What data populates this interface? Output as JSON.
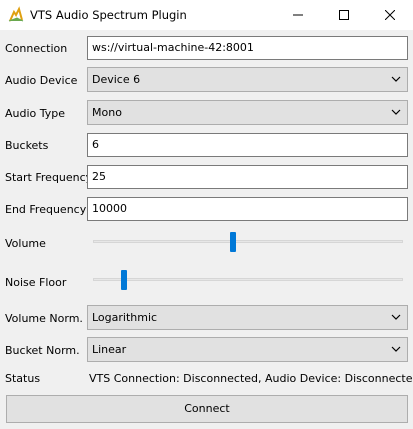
{
  "window": {
    "title": "VTS Audio Spectrum Plugin",
    "icon": "vts-plugin-icon",
    "controls": [
      "minimize-icon",
      "maximize-icon",
      "close-icon"
    ]
  },
  "form": {
    "connection": {
      "label": "Connection",
      "value": "ws://virtual-machine-42:8001"
    },
    "audio_device": {
      "label": "Audio Device",
      "value": "Device 6"
    },
    "audio_type": {
      "label": "Audio Type",
      "value": "Mono"
    },
    "buckets": {
      "label": "Buckets",
      "value": "6"
    },
    "start_frequency": {
      "label": "Start Frequency",
      "value": "25"
    },
    "end_frequency": {
      "label": "End Frequency",
      "value": "10000"
    },
    "volume": {
      "label": "Volume",
      "level": 0.45
    },
    "noise_floor": {
      "label": "Noise Floor",
      "level": 0.1
    },
    "volume_norm": {
      "label": "Volume Norm.",
      "value": "Logarithmic"
    },
    "bucket_norm": {
      "label": "Bucket Norm.",
      "value": "Linear"
    }
  },
  "status": {
    "label": "Status",
    "text": "VTS Connection: Disconnected, Audio Device: Disconnected"
  },
  "actions": {
    "connect_label": "Connect"
  },
  "colors": {
    "accent": "#0078d7",
    "field_bg": "#ffffff",
    "button_bg": "#e1e1e1",
    "window_bg": "#f0f0f0"
  }
}
